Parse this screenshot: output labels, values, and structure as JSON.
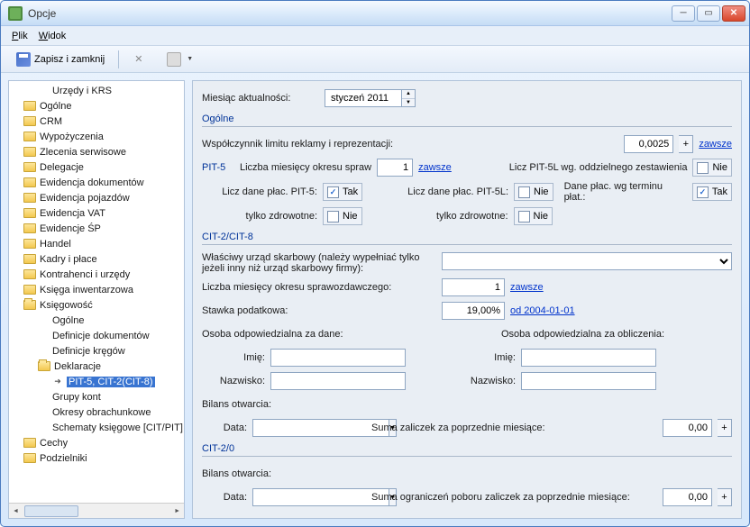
{
  "window": {
    "title": "Opcje"
  },
  "menubar": {
    "file": "Plik",
    "view": "Widok"
  },
  "toolbar": {
    "save_close": "Zapisz i zamknij"
  },
  "tree": [
    {
      "label": "Urzędy i KRS",
      "indent": 3,
      "icon": "none"
    },
    {
      "label": "Ogólne",
      "indent": 1,
      "icon": "folder"
    },
    {
      "label": "CRM",
      "indent": 1,
      "icon": "folder"
    },
    {
      "label": "Wypożyczenia",
      "indent": 1,
      "icon": "folder"
    },
    {
      "label": "Zlecenia serwisowe",
      "indent": 1,
      "icon": "folder"
    },
    {
      "label": "Delegacje",
      "indent": 1,
      "icon": "folder"
    },
    {
      "label": "Ewidencja dokumentów",
      "indent": 1,
      "icon": "folder"
    },
    {
      "label": "Ewidencja pojazdów",
      "indent": 1,
      "icon": "folder"
    },
    {
      "label": "Ewidencja VAT",
      "indent": 1,
      "icon": "folder"
    },
    {
      "label": "Ewidencje ŚP",
      "indent": 1,
      "icon": "folder"
    },
    {
      "label": "Handel",
      "indent": 1,
      "icon": "folder"
    },
    {
      "label": "Kadry i płace",
      "indent": 1,
      "icon": "folder"
    },
    {
      "label": "Kontrahenci i urzędy",
      "indent": 1,
      "icon": "folder"
    },
    {
      "label": "Księga inwentarzowa",
      "indent": 1,
      "icon": "folder"
    },
    {
      "label": "Księgowość",
      "indent": 1,
      "icon": "folder-open"
    },
    {
      "label": "Ogólne",
      "indent": 3,
      "icon": "none"
    },
    {
      "label": "Definicje dokumentów",
      "indent": 3,
      "icon": "none"
    },
    {
      "label": "Definicje kręgów",
      "indent": 3,
      "icon": "none"
    },
    {
      "label": "Deklaracje",
      "indent": 2,
      "icon": "folder-open"
    },
    {
      "label": "PIT-5, CIT-2(CIT-8)",
      "indent": 3,
      "icon": "arrow",
      "selected": true
    },
    {
      "label": "Grupy kont",
      "indent": 3,
      "icon": "none"
    },
    {
      "label": "Okresy obrachunkowe",
      "indent": 3,
      "icon": "none"
    },
    {
      "label": "Schematy księgowe [CIT/PIT]",
      "indent": 3,
      "icon": "none"
    },
    {
      "label": "Cechy",
      "indent": 1,
      "icon": "folder"
    },
    {
      "label": "Podzielniki",
      "indent": 1,
      "icon": "folder"
    }
  ],
  "form": {
    "validity_month_label": "Miesiąc aktualności:",
    "validity_month_value": "styczeń 2011",
    "section_general": "Ogólne",
    "ad_limit_label": "Współczynnik limitu reklamy i reprezentacji:",
    "ad_limit_value": "0,0025",
    "always1": "zawsze",
    "pit5_label": "PIT-5",
    "months_reporting_label": "Liczba miesięcy okresu spraw",
    "months_reporting_value": "1",
    "always2": "zawsze",
    "pit5l_separate_label": "Licz PIT-5L wg. oddzielnego zestawienia",
    "pit5l_separate_value": "Nie",
    "count_pit5_label": "Licz dane płac. PIT-5:",
    "count_pit5_value": "Tak",
    "count_pit5l_label": "Licz dane płac. PIT-5L:",
    "count_pit5l_value": "Nie",
    "by_due_label": "Dane płac. wg terminu płat.:",
    "by_due_value": "Tak",
    "only_health_label": "tylko zdrowotne:",
    "only_health1_value": "Nie",
    "only_health2_value": "Nie",
    "section_cit28": "CIT-2/CIT-8",
    "tax_office_label": "Właściwy urząd skarbowy (należy wypełniać tylko jeżeli inny niż urząd skarbowy firmy):",
    "tax_office_value": "",
    "months_rep2_label": "Liczba miesięcy okresu sprawozdawczego:",
    "months_rep2_value": "1",
    "always3": "zawsze",
    "tax_rate_label": "Stawka podatkowa:",
    "tax_rate_value": "19,00%",
    "tax_rate_link": "od 2004-01-01",
    "resp_data_label": "Osoba odpowiedzialna za dane:",
    "resp_calc_label": "Osoba odpowiedzialna za obliczenia:",
    "firstname_label": "Imię:",
    "lastname_label": "Nazwisko:",
    "opening_balance_label": "Bilans otwarcia:",
    "date_label": "Data:",
    "date_value": "",
    "prev_advances_label": "Suma zaliczek za poprzednie miesiące:",
    "prev_advances_value": "0,00",
    "section_cit20": "CIT-2/0",
    "prev_limits_label": "Suma ograniczeń poboru zaliczek za poprzednie miesiące:",
    "prev_limits_value": "0,00"
  }
}
